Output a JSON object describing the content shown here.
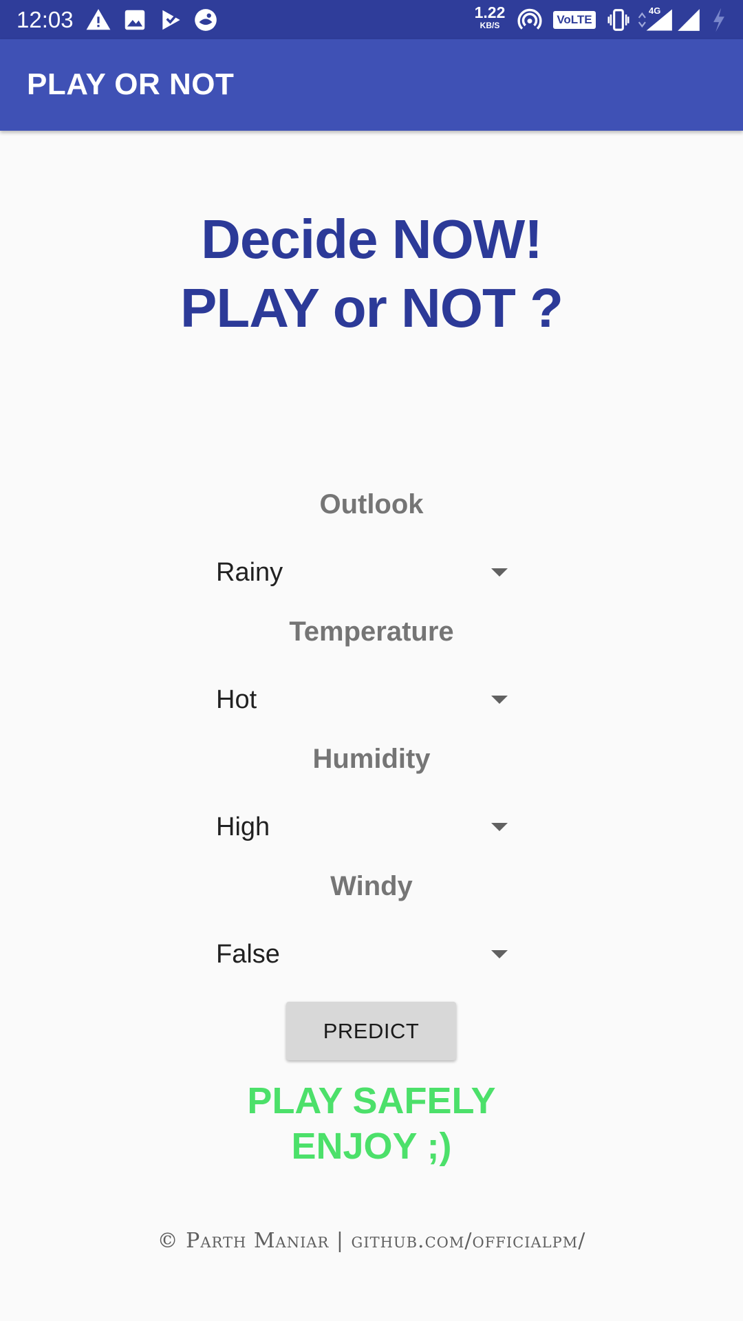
{
  "status_bar": {
    "time": "12:03",
    "speed_value": "1.22",
    "speed_unit": "KB/S",
    "volte_label": "VoLTE",
    "network_label": "4G",
    "icons": [
      "warning-icon",
      "image-icon",
      "play-store-icon",
      "app-icon",
      "hotspot-icon",
      "volte-icon",
      "vibrate-icon",
      "signal-4g-icon",
      "signal-icon",
      "battery-charging-icon"
    ]
  },
  "app_bar": {
    "title": "PLAY OR NOT"
  },
  "headline": {
    "line1": "Decide NOW!",
    "line2": "PLAY or NOT ?"
  },
  "form": {
    "fields": [
      {
        "label": "Outlook",
        "value": "Rainy"
      },
      {
        "label": "Temperature",
        "value": "Hot"
      },
      {
        "label": "Humidity",
        "value": "High"
      },
      {
        "label": "Windy",
        "value": "False"
      }
    ],
    "predict_label": "PREDICT"
  },
  "result": {
    "line1": "PLAY SAFELY",
    "line2": "ENJOY ;)"
  },
  "footer": {
    "text": "© Parth Maniar | github.com/officialpm/"
  },
  "colors": {
    "status_bar": "#2f3d9a",
    "app_bar": "#3f51b5",
    "headline": "#2c3a98",
    "result": "#4ce06a",
    "label": "#757575"
  }
}
